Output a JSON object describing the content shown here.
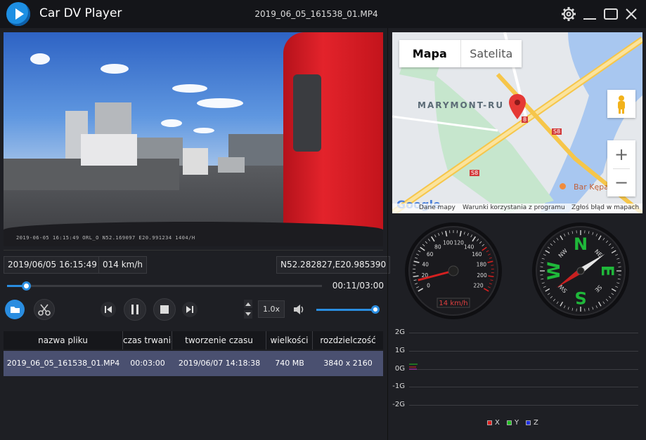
{
  "app": {
    "title": "Car DV Player",
    "current_file": "2019_06_05_161538_01.MP4"
  },
  "video": {
    "overlay_text": "2019-06-05 16:15:49    ORL_O    N52.169097 E20.991234 1404/H"
  },
  "info": {
    "datetime": "2019/06/05 16:15:49",
    "speed": "014 km/h",
    "coords": "N52.282827,E20.985390"
  },
  "playback": {
    "time_label": "00:11/03:00",
    "progress_fraction": 0.0611,
    "speed_label": "1.0x",
    "volume_fraction": 1.0
  },
  "table": {
    "headers": [
      "nazwa pliku",
      "czas trwania",
      "tworzenie czasu",
      "wielkości",
      "rozdzielczość"
    ],
    "rows": [
      [
        "2019_06_05_161538_01.MP4",
        "00:03:00",
        "2019/06/07 14:18:38",
        "740 MB",
        "3840 x 2160"
      ]
    ]
  },
  "map": {
    "tabs": [
      "Mapa",
      "Satelita"
    ],
    "active_tab": "Mapa",
    "place_label": "MARYMONT-RU",
    "road_badge_1": "S8",
    "road_badge_2": "S8",
    "road_badge_3": "8",
    "poi_label": "Bar Kępa",
    "zoom_in": "+",
    "zoom_out": "−",
    "logo": "Google",
    "footer": [
      "Dane mapy",
      "Warunki korzystania z programu",
      "Zgłoś błąd w mapach"
    ],
    "marker_icon": "map-pin-icon",
    "pegman_icon": "street-view-icon"
  },
  "speedometer": {
    "ticks": [
      "0",
      "20",
      "40",
      "60",
      "80",
      "100",
      "120",
      "140",
      "160",
      "180",
      "200",
      "220"
    ],
    "reading": "14 km/h",
    "value": 14
  },
  "compass": {
    "letters": [
      "N",
      "E",
      "S",
      "W"
    ],
    "minor": [
      "NE",
      "SE",
      "SW",
      "NW"
    ],
    "heading_deg": 55
  },
  "gsensor": {
    "y_labels": [
      "2G",
      "1G",
      "0G",
      "-1G",
      "-2G"
    ],
    "legend": [
      {
        "name": "X",
        "color": "#e02020"
      },
      {
        "name": "Y",
        "color": "#20c020"
      },
      {
        "name": "Z",
        "color": "#2030e0"
      }
    ]
  },
  "colors": {
    "accent": "#2a8de0",
    "row_selected": "#4a5070",
    "needle": "#d42020"
  }
}
